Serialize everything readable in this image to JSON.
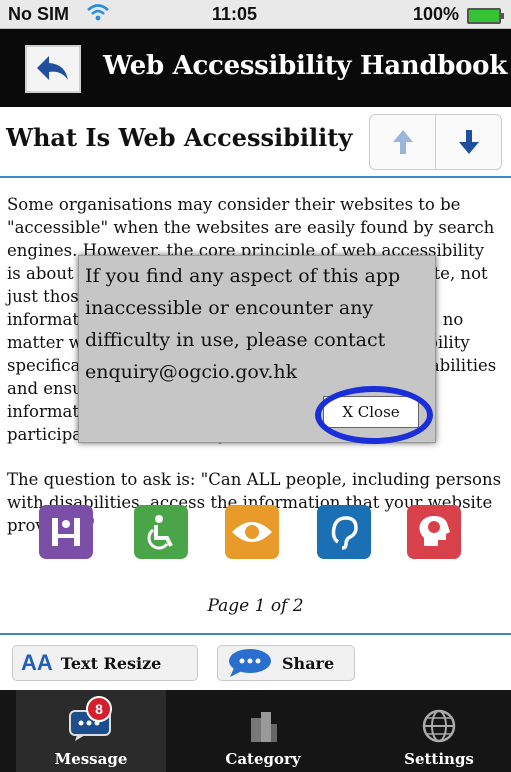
{
  "status_bar": {
    "carrier": "No SIM",
    "time": "11:05",
    "battery": "100%"
  },
  "header": {
    "title": "Web Accessibility Handbook",
    "back_icon": "back-arrow-icon"
  },
  "page": {
    "title": "What Is Web Accessibility",
    "prev_icon": "arrow-up-icon",
    "next_icon": "arrow-down-icon",
    "paragraphs": [
      "Some organisations may consider their websites to be \"accessible\" when the websites are easily found by search engines. However, the core principle of web accessibility is about \"ensuring everyone can access your website, not just those who find you\", it is about making the information on your website available to all people, no matter who they are. This means that web accessibility specifically addresses the needs of people with disabilities and ensures that they can have equal access to information and enjoy equal opportunities with full participation and usability.",
      "The question to ask is: \"Can ALL people, including persons with disabilities, access the information that your website provides?\""
    ],
    "category_icons": [
      "cognitive-desk-icon",
      "wheelchair-icon",
      "eye-icon",
      "ear-icon",
      "head-brain-icon"
    ],
    "page_indicator": "Page 1 of 2"
  },
  "toolbar": {
    "text_resize_label": "Text Resize",
    "text_resize_icon_text": "AA",
    "share_label": "Share"
  },
  "tabs": [
    {
      "label": "Message",
      "icon": "message-icon",
      "badge": "8",
      "active": true
    },
    {
      "label": "Category",
      "icon": "category-buildings-icon",
      "active": false
    },
    {
      "label": "Settings",
      "icon": "globe-settings-icon",
      "active": false
    }
  ],
  "dialog": {
    "message": "If you find any aspect of this app inaccessible or encounter any difficulty in use, please contact enquiry@ogcio.gov.hk",
    "close_label": "X Close"
  },
  "colors": {
    "accent": "#3e86c8",
    "header_bg": "#0a0a0a",
    "highlight": "#1a2fd9",
    "badge": "#d61f2c"
  }
}
